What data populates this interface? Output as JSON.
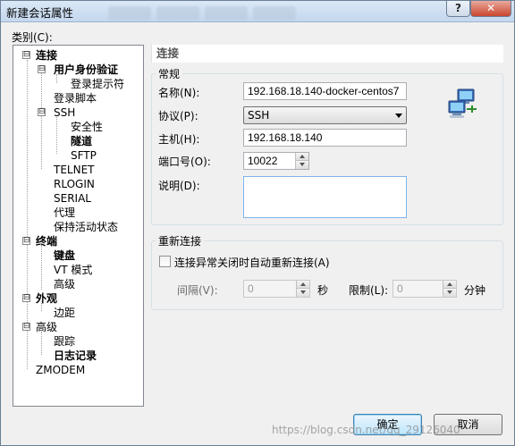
{
  "window": {
    "title": "新建会话属性",
    "help_glyph": "?",
    "close_glyph": "✕"
  },
  "category": {
    "label": "类别(C):",
    "tree": [
      {
        "label": "连接",
        "bold": true,
        "expander": "⊟"
      },
      {
        "label": "用户身份验证",
        "bold": true,
        "expander": "⊟"
      },
      {
        "label": "登录提示符",
        "bold": false
      },
      {
        "label": "登录脚本",
        "bold": false
      },
      {
        "label": "SSH",
        "bold": false,
        "expander": "⊟"
      },
      {
        "label": "安全性",
        "bold": false
      },
      {
        "label": "隧道",
        "bold": true
      },
      {
        "label": "SFTP",
        "bold": false
      },
      {
        "label": "TELNET",
        "bold": false
      },
      {
        "label": "RLOGIN",
        "bold": false
      },
      {
        "label": "SERIAL",
        "bold": false
      },
      {
        "label": "代理",
        "bold": false
      },
      {
        "label": "保持活动状态",
        "bold": false
      },
      {
        "label": "终端",
        "bold": true,
        "expander": "⊟"
      },
      {
        "label": "键盘",
        "bold": true
      },
      {
        "label": "VT 模式",
        "bold": false
      },
      {
        "label": "高级",
        "bold": false
      },
      {
        "label": "外观",
        "bold": true,
        "expander": "⊟"
      },
      {
        "label": "边距",
        "bold": false
      },
      {
        "label": "高级",
        "bold": false,
        "expander": "⊟"
      },
      {
        "label": "跟踪",
        "bold": false
      },
      {
        "label": "日志记录",
        "bold": true
      },
      {
        "label": "ZMODEM",
        "bold": false
      }
    ]
  },
  "panel": {
    "header": "连接",
    "general": {
      "title": "常规",
      "name_label": "名称(N):",
      "name_value": "192.168.18.140-docker-centos7",
      "protocol_label": "协议(P):",
      "protocol_value": "SSH",
      "host_label": "主机(H):",
      "host_value": "192.168.18.140",
      "port_label": "端口号(O):",
      "port_value": "10022",
      "desc_label": "说明(D):",
      "desc_value": ""
    },
    "reconnect": {
      "title": "重新连接",
      "checkbox_label": "连接异常关闭时自动重新连接(A)",
      "interval_label": "间隔(V):",
      "interval_value": "0",
      "interval_unit": "秒",
      "limit_label": "限制(L):",
      "limit_value": "0",
      "limit_unit": "分钟"
    }
  },
  "buttons": {
    "ok": "确定",
    "cancel": "取消"
  },
  "watermark": "https://blog.csdn.net/qq_29126040",
  "icons": [
    "network-computers-icon",
    "spin-up-icon",
    "spin-down-icon",
    "dropdown-arrow-icon"
  ]
}
